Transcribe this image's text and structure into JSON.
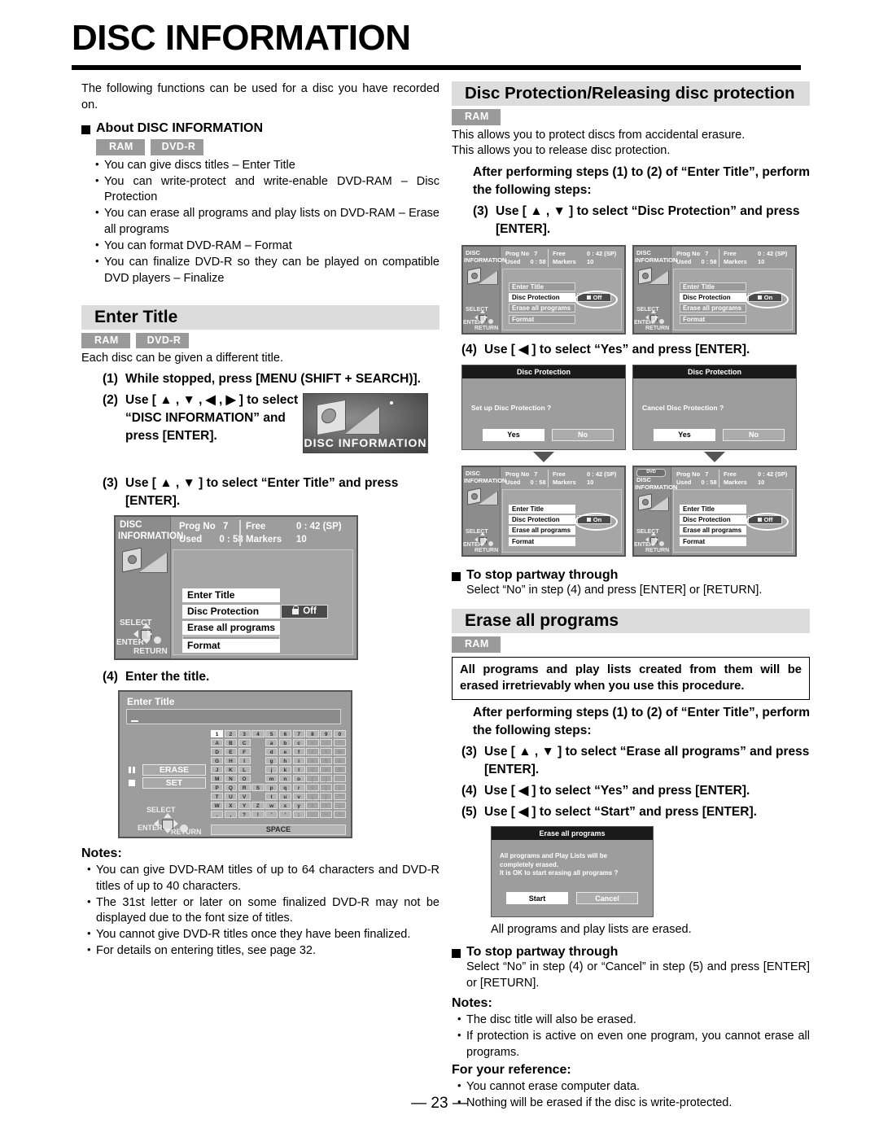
{
  "page": {
    "title": "DISC INFORMATION",
    "page_number": "— 23 —"
  },
  "intro": {
    "text": "The following functions can be used for a disc you have recorded on."
  },
  "about": {
    "heading": "About DISC INFORMATION",
    "badges": [
      "RAM",
      "DVD-R"
    ],
    "bullets": [
      "You can give discs titles – Enter Title",
      "You can write-protect and write-enable DVD-RAM – Disc Protection",
      "You can erase all programs and play lists on DVD-RAM – Erase all programs",
      "You can format DVD-RAM – Format",
      "You can finalize DVD-R so they can be played on compatible DVD players – Finalize"
    ]
  },
  "enter_title": {
    "section_title": "Enter Title",
    "badges": [
      "RAM",
      "DVD-R"
    ],
    "lead": "Each disc can be given a different title.",
    "steps": [
      {
        "num": "(1)",
        "text": "While stopped, press [MENU (SHIFT + SEARCH)]."
      },
      {
        "num": "(2)",
        "text": "Use [ ▲ , ▼ , ◀ , ▶ ] to select “DISC INFORMATION” and press [ENTER]."
      },
      {
        "num": "(3)",
        "text": "Use [ ▲ , ▼ ] to select “Enter Title” and press [ENTER]."
      },
      {
        "num": "(4)",
        "text": "Enter the title."
      }
    ],
    "menu_thumb_label": "DISC INFORMATION",
    "notes_heading": "Notes:",
    "notes": [
      "You can give DVD-RAM titles of up to 64 characters and DVD-R titles of up to 40 characters.",
      "The 31st letter or later on some finalized DVD-R may not be displayed due to the font size of titles.",
      "You cannot give DVD-R titles once they have been finalized.",
      "For details on entering titles, see page 32."
    ]
  },
  "disc_info_screen": {
    "side_label_line1": "DISC",
    "side_label_line2": "INFORMATION",
    "nav_select": "SELECT",
    "nav_enter": "ENTER",
    "nav_return": "RETURN",
    "stats": [
      {
        "label": "Prog No",
        "value": "7"
      },
      {
        "label": "Free",
        "value": "0 : 42 (SP)"
      },
      {
        "label": "Used",
        "value": "0 : 58"
      },
      {
        "label": "Markers",
        "value": "10"
      }
    ],
    "menu": [
      "Enter Title",
      "Disc Protection",
      "Erase all programs",
      "Format"
    ],
    "protection_off": "Off",
    "protection_on": "On",
    "dvd_badge": "DVD"
  },
  "keyboard_screen": {
    "title": "Enter Title",
    "erase_label": "ERASE",
    "set_label": "SET",
    "space_label": "SPACE",
    "nav_select": "SELECT",
    "nav_enter": "ENTER",
    "nav_return": "RETURN",
    "rows": [
      [
        "1",
        "2",
        "3",
        "4",
        "5",
        "6",
        "7",
        "8",
        "9",
        "0"
      ],
      [
        "A",
        "B",
        "C",
        "",
        "a",
        "b",
        "c",
        "+",
        "–",
        "*"
      ],
      [
        "D",
        "E",
        "F",
        "",
        "d",
        "e",
        "f",
        "/",
        "=",
        "%"
      ],
      [
        "G",
        "H",
        "I",
        "",
        "g",
        "h",
        "i",
        "#",
        "$",
        "&"
      ],
      [
        "J",
        "K",
        "L",
        "",
        "j",
        "k",
        "l",
        "<",
        ">",
        "@"
      ],
      [
        "M",
        "N",
        "O",
        "",
        "m",
        "n",
        "o",
        "[",
        "]",
        "_"
      ],
      [
        "P",
        "Q",
        "R",
        "S",
        "p",
        "q",
        "r",
        "s",
        "(",
        ")"
      ],
      [
        "T",
        "U",
        "V",
        "",
        "t",
        "u",
        "v",
        "{",
        "}",
        "\""
      ],
      [
        "W",
        "X",
        "Y",
        "Z",
        "w",
        "x",
        "y",
        "z",
        "\\",
        "|"
      ],
      [
        ".",
        ",",
        "?",
        "!",
        "’",
        "‘",
        ":",
        ";",
        "~",
        "^"
      ]
    ]
  },
  "disc_protection": {
    "section_title": "Disc Protection/Releasing disc protection",
    "badges": [
      "RAM"
    ],
    "lead_1": "This allows you to protect discs from accidental erasure.",
    "lead_2": "This allows you to release disc protection.",
    "after_steps": "After performing steps (1) to (2) of “Enter Title”, perform the following steps:",
    "step3": {
      "num": "(3)",
      "text": "Use [ ▲ , ▼ ] to select “Disc Protection” and press [ENTER]."
    },
    "step4": {
      "num": "(4)",
      "text": "Use [ ◀ ] to select “Yes” and press [ENTER]."
    },
    "dialog_title": "Disc Protection",
    "dialog_setup_question": "Set up Disc Protection ?",
    "dialog_cancel_question": "Cancel Disc Protection ?",
    "yes_label": "Yes",
    "no_label": "No",
    "stop_heading": "To stop partway through",
    "stop_text": "Select “No” in step (4) and press [ENTER] or [RETURN]."
  },
  "erase_all": {
    "section_title": "Erase all programs",
    "badges": [
      "RAM"
    ],
    "warning": "All programs and play lists created from them will be erased irretrievably when you use this procedure.",
    "after_steps": "After performing steps (1) to (2) of “Enter Title”, perform the following steps:",
    "step3": {
      "num": "(3)",
      "text": "Use [ ▲ , ▼ ] to select “Erase all programs” and press [ENTER]."
    },
    "step4": {
      "num": "(4)",
      "text": "Use [ ◀ ] to select “Yes” and press [ENTER]."
    },
    "step5": {
      "num": "(5)",
      "text": "Use [ ◀ ] to select “Start” and press [ENTER]."
    },
    "dialog_title": "Erase all programs",
    "dialog_line1": "All programs and Play Lists will be",
    "dialog_line2": "completely erased.",
    "dialog_line3": "It is OK to start erasing all programs ?",
    "start_label": "Start",
    "cancel_label": "Cancel",
    "caption": "All programs and play lists are erased.",
    "stop_heading": "To stop partway through",
    "stop_text": "Select “No” in step (4) or “Cancel” in step (5) and press [ENTER] or [RETURN].",
    "notes_heading": "Notes:",
    "notes": [
      "The disc title will also be erased.",
      "If protection is active on even one program, you cannot erase all programs."
    ],
    "reference_heading": "For your reference:",
    "reference_notes": [
      "You cannot erase computer data.",
      "Nothing will be erased if the disc is write-protected."
    ]
  },
  "colors": {
    "section_bar": "#dcdcdc",
    "badge": "#9a9a9a",
    "tv_bg": "#9d9d9d",
    "dialog_title_bg": "#1a1a1a"
  }
}
